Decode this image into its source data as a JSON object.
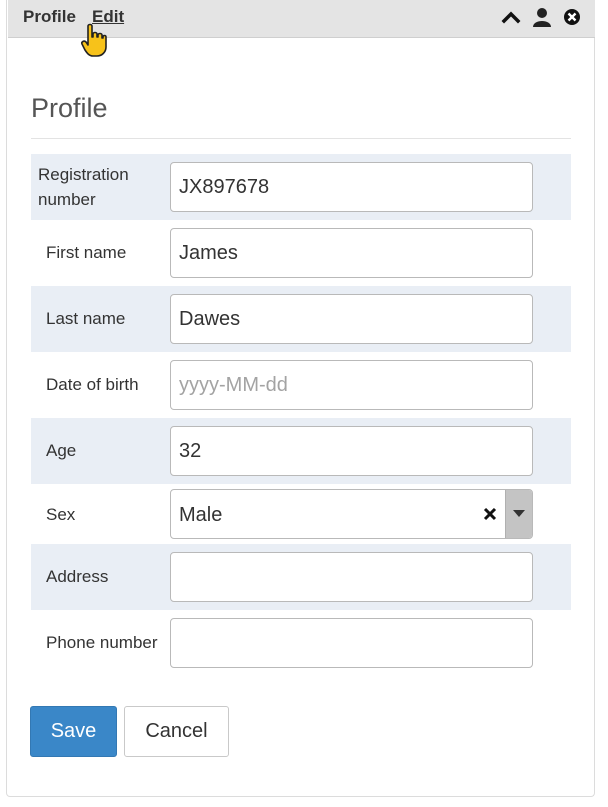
{
  "header": {
    "title": "Profile",
    "edit_label": "Edit",
    "icons": [
      "chevron-up-icon",
      "user-icon",
      "close-circle-icon"
    ]
  },
  "section": {
    "title": "Profile"
  },
  "form": {
    "registration": {
      "label": "Registration number",
      "value": "JX897678"
    },
    "first_name": {
      "label": "First name",
      "value": "James"
    },
    "last_name": {
      "label": "Last name",
      "value": "Dawes"
    },
    "dob": {
      "label": "Date of birth",
      "value": "",
      "placeholder": "yyyy-MM-dd"
    },
    "age": {
      "label": "Age",
      "value": "32"
    },
    "sex": {
      "label": "Sex",
      "value": "Male"
    },
    "address": {
      "label": "Address",
      "value": ""
    },
    "phone": {
      "label": "Phone number",
      "value": ""
    }
  },
  "buttons": {
    "save": "Save",
    "cancel": "Cancel"
  },
  "colors": {
    "primary": "#3a87c8",
    "row_shade": "#e9eef5",
    "header_bg": "#e4e4e4"
  }
}
